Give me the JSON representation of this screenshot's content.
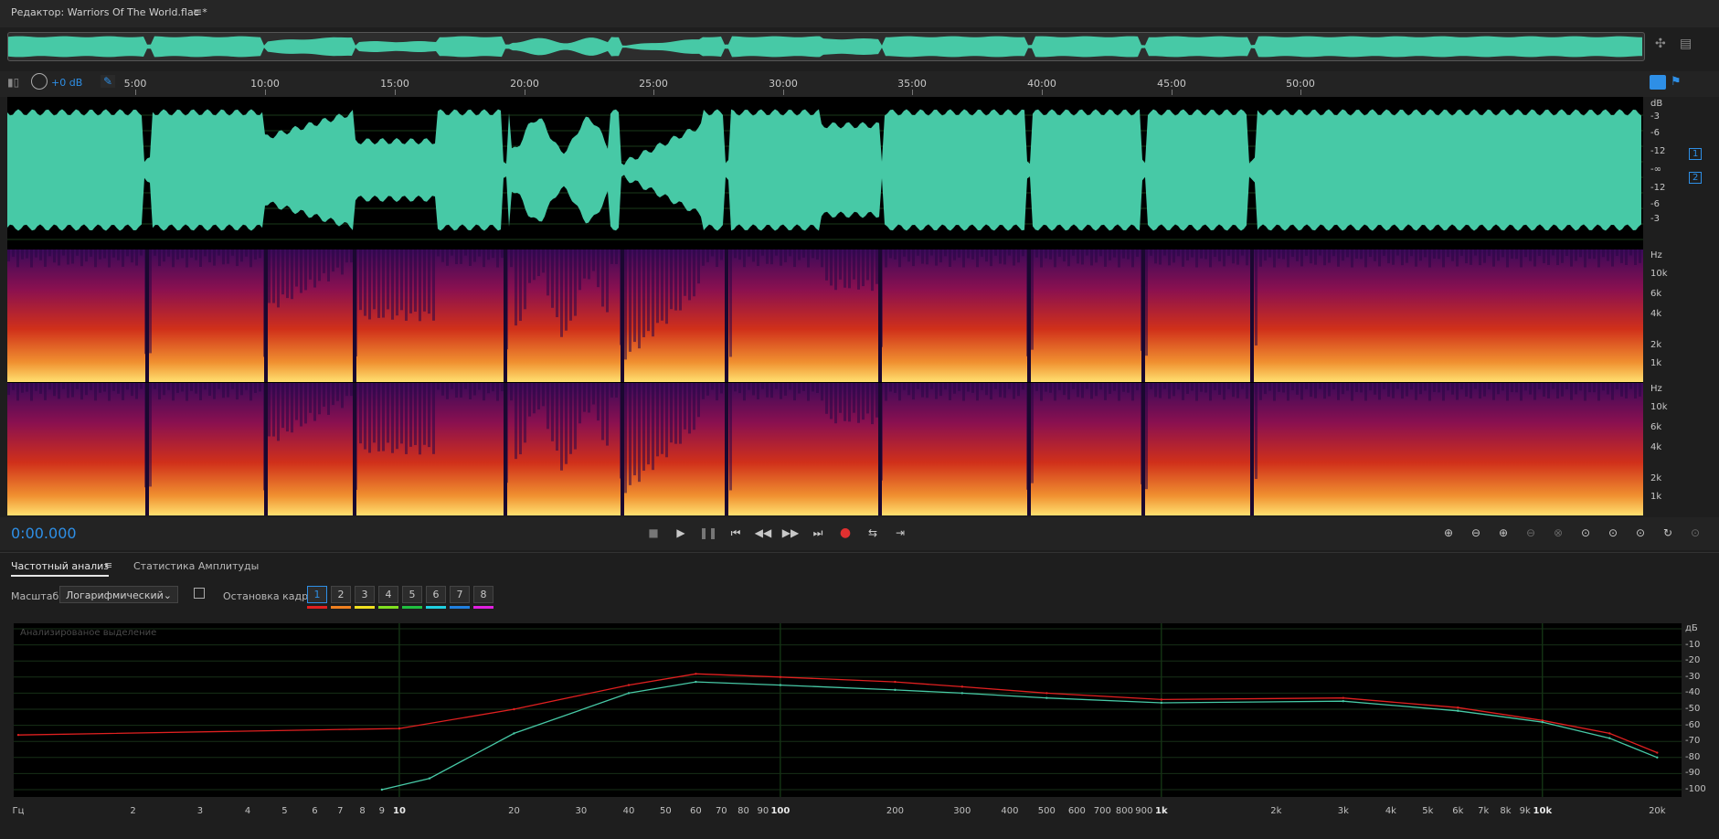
{
  "titlebar": {
    "title": "Редактор: Warriors Of The World.flac *",
    "menu_icon": "hamburger-icon"
  },
  "level": {
    "label": "+0 dB"
  },
  "ruler": {
    "ticks": [
      "5:00",
      "10:00",
      "15:00",
      "20:00",
      "25:00",
      "30:00",
      "35:00",
      "40:00",
      "45:00",
      "50:00"
    ]
  },
  "amp_scale": [
    "dB",
    "-3",
    "-6",
    "-12",
    "-∞",
    "-12",
    "-6",
    "-3"
  ],
  "channels": [
    "1",
    "2"
  ],
  "freq_scale": [
    "Hz",
    "10k",
    "6k",
    "4k",
    "2k",
    "1k"
  ],
  "transport": {
    "timecode": "0:00.000"
  },
  "panel": {
    "tab_freq": "Частотный анализ",
    "tab_amp": "Статистика Амплитуды",
    "scale_label": "Масштаб:",
    "scale_value": "Логарифмический",
    "frame_label": "Остановка кадра:",
    "frames": [
      {
        "label": "1",
        "color": "#e02020"
      },
      {
        "label": "2",
        "color": "#f08020"
      },
      {
        "label": "3",
        "color": "#f0e020"
      },
      {
        "label": "4",
        "color": "#80e020"
      },
      {
        "label": "5",
        "color": "#20c040"
      },
      {
        "label": "6",
        "color": "#20d0e0"
      },
      {
        "label": "7",
        "color": "#2080e0"
      },
      {
        "label": "8",
        "color": "#e020e0"
      }
    ],
    "graph_label": "Анализированое выделение",
    "x_ticks": [
      "Гц",
      "2",
      "3",
      "4",
      "5",
      "6",
      "7",
      "8",
      "9",
      "10",
      "20",
      "30",
      "40",
      "50",
      "60",
      "70",
      "80",
      "90",
      "100",
      "200",
      "300",
      "400",
      "500",
      "600",
      "700",
      "800",
      "900",
      "1k",
      "2k",
      "3k",
      "4k",
      "5k",
      "6k",
      "7k",
      "8k",
      "9k",
      "10k",
      "20k"
    ],
    "y_ticks": [
      "дБ",
      "-10",
      "-20",
      "-30",
      "-40",
      "-50",
      "-60",
      "-70",
      "-80",
      "-90",
      "-100"
    ]
  },
  "colors": {
    "waveform": "#47c9a6",
    "accent": "#2e8fe6",
    "record": "#e03030"
  },
  "chart_data": {
    "type": "line",
    "xscale": "log",
    "xlim": [
      1,
      22050
    ],
    "ylim": [
      -100,
      0
    ],
    "series": [
      {
        "color": "#e02020",
        "x": [
          1,
          10,
          20,
          40,
          60,
          100,
          200,
          300,
          500,
          1000,
          3000,
          6000,
          10000,
          15000,
          20000
        ],
        "y": [
          -66,
          -62,
          -50,
          -35,
          -28,
          -30,
          -33,
          -36,
          -40,
          -44,
          -43,
          -49,
          -57,
          -65,
          -77
        ]
      },
      {
        "color": "#47c9a6",
        "x": [
          9,
          12,
          20,
          40,
          60,
          100,
          200,
          300,
          500,
          1000,
          3000,
          6000,
          10000,
          15000,
          20000
        ],
        "y": [
          -100,
          -93,
          -65,
          -40,
          -33,
          -35,
          -38,
          -40,
          -43,
          -46,
          -45,
          -51,
          -58,
          -68,
          -80
        ]
      }
    ]
  }
}
